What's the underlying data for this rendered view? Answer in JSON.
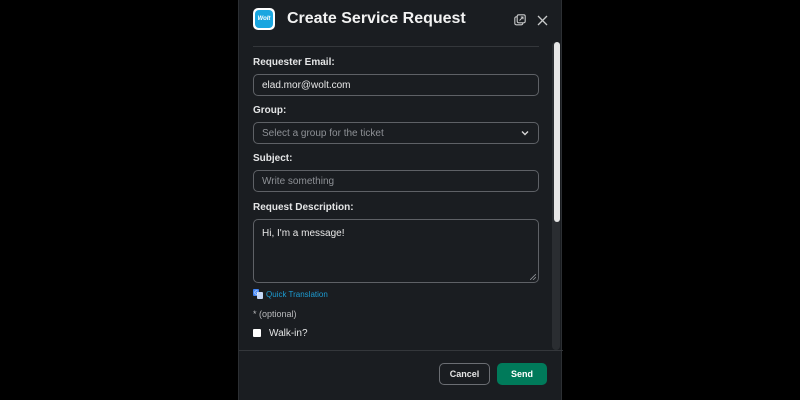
{
  "modal": {
    "title": "Create Service Request",
    "app_icon_text": "Wolt",
    "icons": {
      "popout": "popout-icon",
      "close": "close-icon"
    }
  },
  "form": {
    "requester_email": {
      "label": "Requester Email:",
      "value": "elad.mor@wolt.com"
    },
    "group": {
      "label": "Group:",
      "placeholder": "Select a group for the ticket"
    },
    "subject": {
      "label": "Subject:",
      "placeholder": "Write something"
    },
    "description": {
      "label": "Request Description:",
      "value": "Hi, I'm a message!"
    },
    "quick_translation": "Quick Translation",
    "optional_note": "* (optional)",
    "walk_in": {
      "label": "Walk-in?",
      "checked": false
    }
  },
  "footer": {
    "cancel_label": "Cancel",
    "send_label": "Send"
  },
  "colors": {
    "background": "#1a1d21",
    "accent_send": "#007a5a",
    "link": "#1d9bd1",
    "app_icon": "#1aa6e0"
  }
}
